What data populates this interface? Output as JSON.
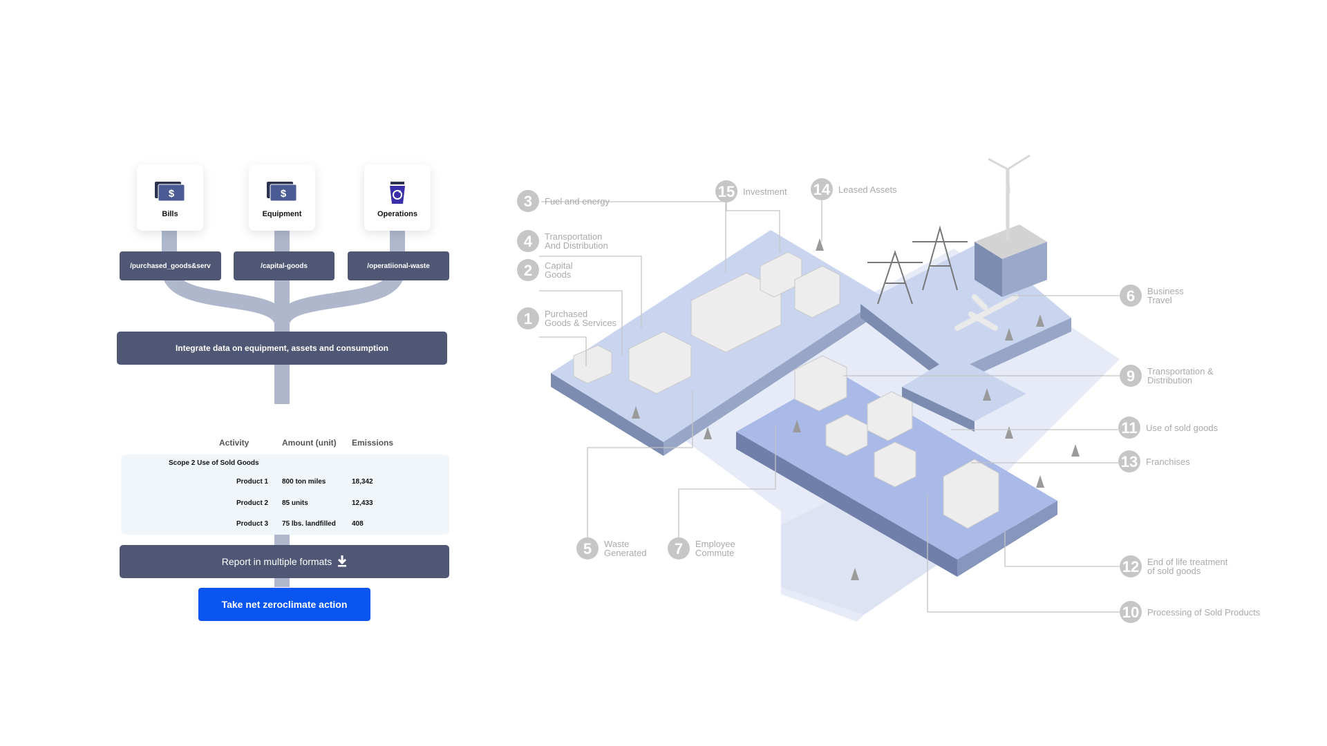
{
  "sources": [
    {
      "label": "Bills",
      "icon": "dollar-bill-icon"
    },
    {
      "label": "Equipment",
      "icon": "dollar-bill-icon"
    },
    {
      "label": "Operations",
      "icon": "recycle-bin-icon"
    }
  ],
  "endpoints": [
    "/purchased_goods&serv",
    "/capital-goods",
    "/operatiional-waste"
  ],
  "integrate_label": "Integrate data on equipment, assets and consumption",
  "table": {
    "headers": [
      "Activity",
      "Amount (unit)",
      "Emissions"
    ],
    "group": "Scope 2 Use of Sold Goods",
    "rows": [
      {
        "activity": "Product 1",
        "amount": "800 ton miles",
        "emissions": "18,342"
      },
      {
        "activity": "Product 2",
        "amount": "85 units",
        "emissions": "12,433"
      },
      {
        "activity": "Product 3",
        "amount": "75 lbs. landfilled",
        "emissions": "408"
      }
    ]
  },
  "report_label": "Report in multiple formats",
  "cta_label": "Take net zeroclimate action",
  "categories": [
    {
      "num": "3",
      "text": "Fuel and energy"
    },
    {
      "num": "4",
      "text": "Transportation\nAnd Distribution"
    },
    {
      "num": "2",
      "text": "Capital\nGoods"
    },
    {
      "num": "1",
      "text": "Purchased\nGoods & Services"
    },
    {
      "num": "15",
      "text": "Investment"
    },
    {
      "num": "14",
      "text": "Leased Assets"
    },
    {
      "num": "6",
      "text": "Business\nTravel"
    },
    {
      "num": "9",
      "text": "Transportation &\nDistribution"
    },
    {
      "num": "11",
      "text": "Use of sold goods"
    },
    {
      "num": "13",
      "text": "Franchises"
    },
    {
      "num": "12",
      "text": "End of life treatment\nof sold goods"
    },
    {
      "num": "10",
      "text": "Processing of Sold Products"
    },
    {
      "num": "5",
      "text": "Waste\nGenerated"
    },
    {
      "num": "7",
      "text": "Employee\nCommute"
    }
  ],
  "colors": {
    "panel": "#4f5775",
    "cta": "#0a55ef",
    "pipe": "#a6b0c6",
    "platform": "#c9d4ee",
    "label_gray": "#aaaaaa"
  }
}
